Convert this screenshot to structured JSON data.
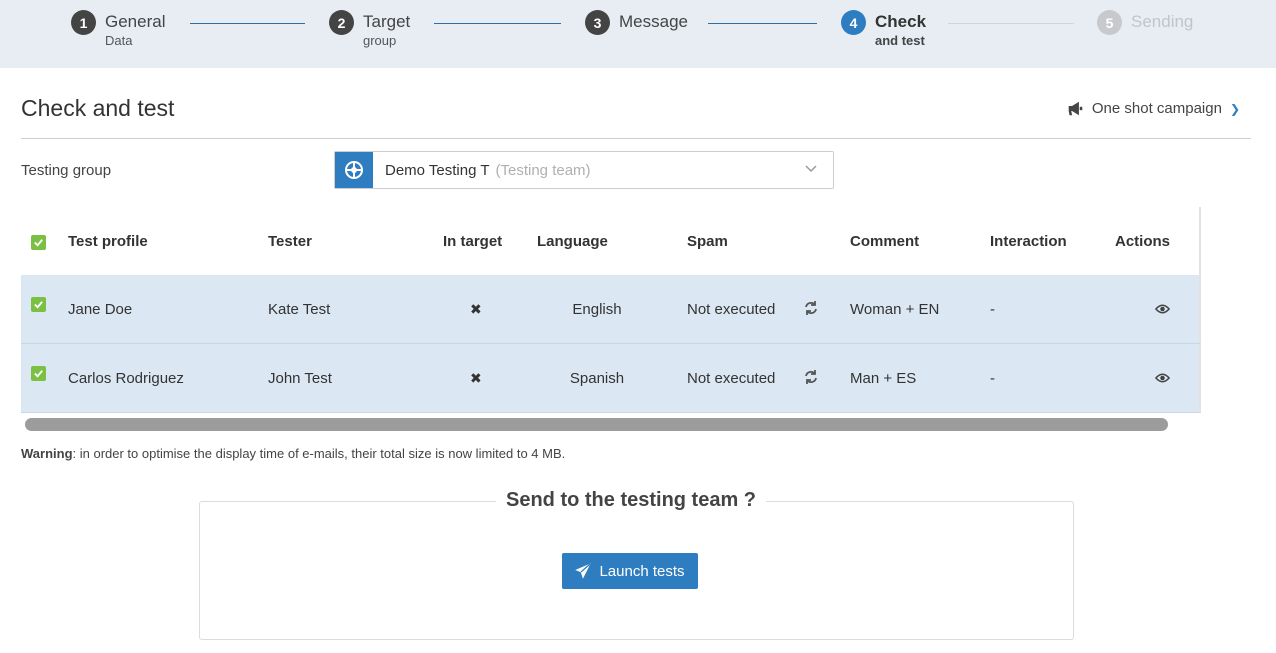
{
  "stepper": {
    "steps": [
      {
        "num": "1",
        "title": "General",
        "sub": "Data",
        "state": "done"
      },
      {
        "num": "2",
        "title": "Target",
        "sub": "group",
        "state": "done"
      },
      {
        "num": "3",
        "title": "Message",
        "sub": "",
        "state": "done"
      },
      {
        "num": "4",
        "title": "Check",
        "sub": "and test",
        "state": "active"
      },
      {
        "num": "5",
        "title": "Sending",
        "sub": "",
        "state": "disabled"
      }
    ]
  },
  "header": {
    "title": "Check and test",
    "campaign_type": "One shot campaign",
    "campaign_icon": "megaphone-icon"
  },
  "testing_group": {
    "label": "Testing group",
    "value": "Demo Testing T",
    "value_sub": "(Testing team)"
  },
  "table": {
    "columns": [
      "Test profile",
      "Tester",
      "In target",
      "Language",
      "Spam",
      "Comment",
      "Interaction",
      "Actions"
    ],
    "rows": [
      {
        "profile": "Jane Doe",
        "tester": "Kate Test",
        "in_target": "✖",
        "language": "English",
        "spam": "Not executed",
        "comment": "Woman + EN",
        "interaction": "-",
        "checked": true
      },
      {
        "profile": "Carlos Rodriguez",
        "tester": "John Test",
        "in_target": "✖",
        "language": "Spanish",
        "spam": "Not executed",
        "comment": "Man + ES",
        "interaction": "-",
        "checked": true
      }
    ]
  },
  "warning": {
    "label": "Warning",
    "text": ": in order to optimise the display time of e-mails, their total size is now limited to 4 MB."
  },
  "send": {
    "title": "Send to the testing team ?",
    "button": "Launch tests"
  },
  "colors": {
    "accent": "#2e7dc0",
    "checkbox": "#7cc043",
    "row_bg": "#dbe7f3",
    "stepper_bg": "#e8edf3"
  }
}
